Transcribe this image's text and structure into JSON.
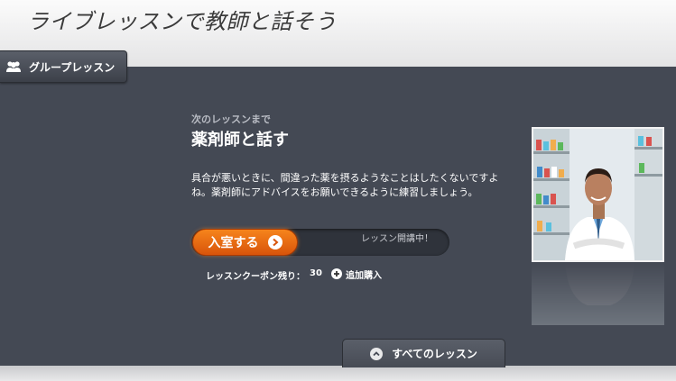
{
  "header": {
    "title": "ライブレッスンで教師と話そう"
  },
  "tab": {
    "label": "グループレッスン",
    "icon": "group-icon"
  },
  "lesson": {
    "sub_label": "次のレッスンまで",
    "title": "薬剤師と話す",
    "description": "具合が悪いときに、間違った薬を摂るようなことはしたくないですよね。薬剤師にアドバイスをお願いできるように練習しましょう。",
    "enter_label": "入室する",
    "status": "レッスン開講中！",
    "coupon_label": "レッスンクーポン残り：",
    "coupon_count": "30",
    "buy_label": "追加購入"
  },
  "footer": {
    "all_lessons_label": "すべてのレッスン"
  },
  "colors": {
    "accent": "#e8680f",
    "panel": "#444954",
    "header_bg": "#f2f2f2"
  }
}
